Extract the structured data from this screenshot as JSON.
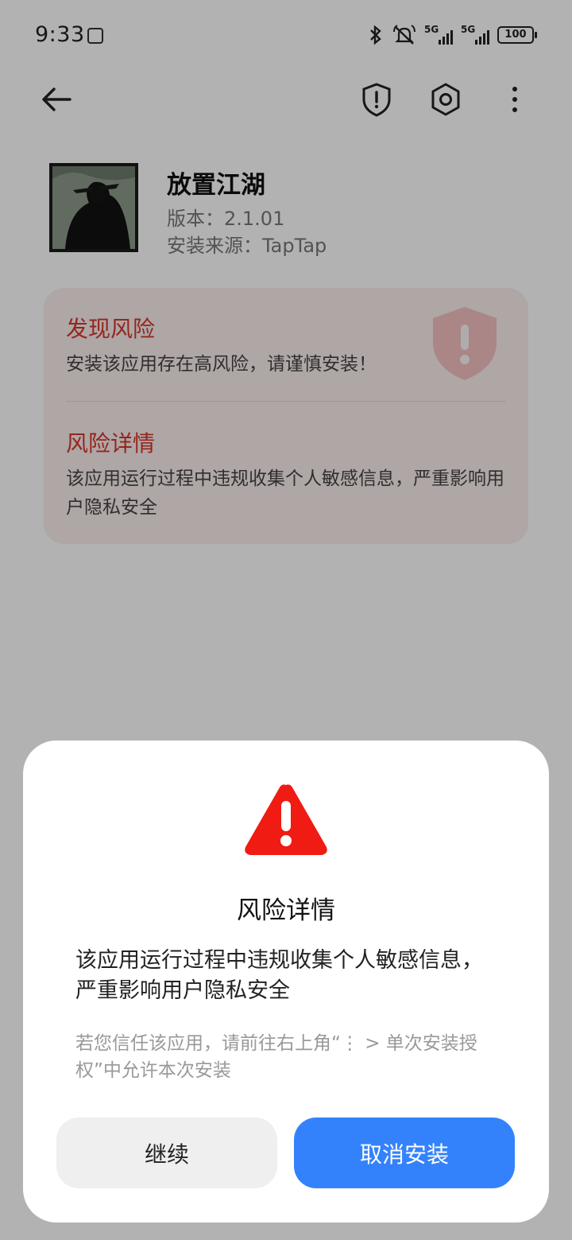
{
  "status_bar": {
    "time": "9:33",
    "network_1": "5G",
    "network_2": "5G",
    "battery": "100"
  },
  "app": {
    "name": "放置江湖",
    "version": "版本：2.1.01",
    "source": "安装来源：TapTap"
  },
  "risk_card": {
    "found_title": "发现风险",
    "found_desc": "安装该应用存在高风险，请谨慎安装！",
    "detail_title": "风险详情",
    "detail_desc": "该应用运行过程中违规收集个人敏感信息，严重影响用户隐私安全"
  },
  "dialog": {
    "title": "风险详情",
    "body": "该应用运行过程中违规收集个人敏感信息，严重影响用户隐私安全",
    "hint": "若您信任该应用，请前往右上角“⋮ > 单次安装授权”中允许本次安装",
    "continue_label": "继续",
    "cancel_label": "取消安装"
  },
  "colors": {
    "risk_red": "#d4372c",
    "primary_blue": "#3482fb",
    "warning_red": "#f01b12"
  },
  "icons": [
    "back-arrow-icon",
    "shield-alert-icon",
    "settings-icon",
    "more-vert-icon",
    "warning-triangle-icon"
  ]
}
